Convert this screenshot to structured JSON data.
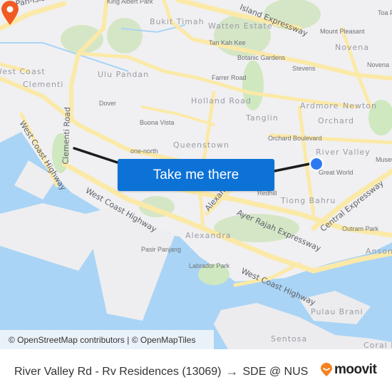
{
  "map": {
    "colors": {
      "land": "#f0f0f2",
      "water": "#aad4f5",
      "park": "#cfe8c0",
      "road": "#fbe9a8",
      "route_line": "#1c1c1c",
      "origin": "#2e7bf0",
      "destination": "#f15a22",
      "cta": "#0d72d6"
    },
    "labels": {
      "areas": [
        "Bukit Timah",
        "Watten Estate",
        "Novena",
        "Ulu Pandan",
        "Holland Road",
        "Tanglin",
        "Ardmore",
        "Newton",
        "Orchard",
        "River Valley",
        "Queenstown",
        "Tiong Bahru",
        "Alexandra",
        "Anson",
        "Pulau Brani",
        "Sentosa",
        "West Coast",
        "Clementi",
        "Coral Island"
      ],
      "roads": [
        "Pan-Island Expressway",
        "Island Expressway",
        "West Coast Highway",
        "Clementi Road",
        "Alexandra Road",
        "Ayer Rajah Expressway",
        "Central Expressway"
      ],
      "pois": [
        "King Albert Park",
        "Tan Kah Kee",
        "Botanic Gardens",
        "Mount Pleasant",
        "Stevens",
        "Farrer Road",
        "Novena",
        "Toa Payoh",
        "Dover",
        "Buona Vista",
        "one-north",
        "Orchard Boulevard",
        "Great World",
        "Redhill",
        "Outram Park",
        "Pasir Panjang",
        "Labrador Park",
        "Museum"
      ]
    },
    "origin_icon": "origin-dot-icon",
    "destination_icon": "destination-pin-icon"
  },
  "cta": {
    "label": "Take me there"
  },
  "attribution": {
    "text": "© OpenStreetMap contributors | © OpenMapTiles"
  },
  "footer": {
    "origin": "River Valley Rd - Rv Residences (13069)",
    "arrow": "→",
    "destination": "SDE @ NUS",
    "brand": "moovit"
  }
}
